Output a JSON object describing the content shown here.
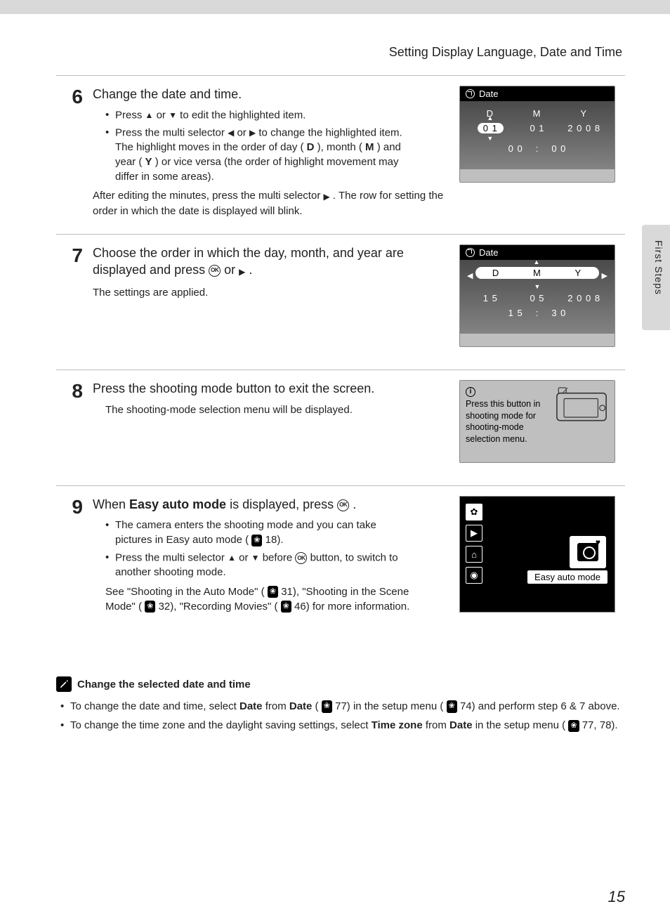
{
  "header": {
    "title": "Setting Display Language, Date and Time"
  },
  "side_label": "First Steps",
  "page_number": "15",
  "ok_label": "OK",
  "steps": {
    "s6": {
      "num": "6",
      "title": "Change the date and time.",
      "bullets": [
        {
          "pre": "Press ",
          "post": " to edit the highlighted item."
        },
        {
          "t1": "Press the multi selector ",
          "t2": " to change the highlighted item. The highlight moves in the order of day (",
          "d": "D",
          "t3": "), month (",
          "m": "M",
          "t4": ") and year (",
          "y": "Y",
          "t5": ") or vice versa (the order of highlight movement may differ in some areas)."
        }
      ],
      "after": "After editing the minutes, press the multi selector ",
      "after2": ". The row for setting the order in which the date is displayed will blink.",
      "panel": {
        "title": "Date",
        "labels": {
          "d": "D",
          "m": "M",
          "y": "Y"
        },
        "values": {
          "d": "0 1",
          "m": "0 1",
          "y": "2 0 0 8"
        },
        "time": {
          "h": "0 0",
          "m": "0 0"
        }
      }
    },
    "s7": {
      "num": "7",
      "title_a": "Choose the order in which the day, month, and year are displayed and press ",
      "title_b": " or ",
      "title_c": ".",
      "para": "The settings are applied.",
      "panel": {
        "title": "Date",
        "labels": {
          "d": "D",
          "m": "M",
          "y": "Y"
        },
        "values": {
          "d": "1 5",
          "m": "0 5",
          "y": "2 0 0 8"
        },
        "time": {
          "h": "1 5",
          "m": "3 0"
        }
      }
    },
    "s8": {
      "num": "8",
      "title": "Press the shooting mode button to exit the screen.",
      "para": "The shooting-mode selection menu will be displayed.",
      "info": "Press this button in shooting mode for shooting-mode selection menu."
    },
    "s9": {
      "num": "9",
      "title_a": "When ",
      "title_b": "Easy auto mode",
      "title_c": " is displayed, press ",
      "title_d": ".",
      "bullets": {
        "b1a": "The camera enters the shooting mode and you can take pictures in Easy auto mode (",
        "b1b": " 18).",
        "b2a": "Press the multi selector ",
        "b2b": " before ",
        "b2c": " button, to switch to another shooting mode."
      },
      "para_a": "See \"Shooting in the Auto Mode\" (",
      "para_b": " 31), \"Shooting in the Scene Mode\" (",
      "para_c": " 32), \"Recording Movies\" (",
      "para_d": " 46) for more information.",
      "panel_label": "Easy auto mode"
    }
  },
  "note": {
    "title": "Change the selected date and time",
    "b1a": "To change the date and time, select ",
    "b1b": "Date",
    "b1c": " from ",
    "b1d": "Date",
    "b1e": " (",
    "b1f": " 77) in the setup menu (",
    "b1g": " 74) and perform step 6 & 7 above.",
    "b2a": "To change the time zone and the daylight saving settings, select ",
    "b2b": "Time zone",
    "b2c": " from ",
    "b2d": "Date",
    "b2e": " in the setup menu (",
    "b2f": " 77, 78)."
  }
}
